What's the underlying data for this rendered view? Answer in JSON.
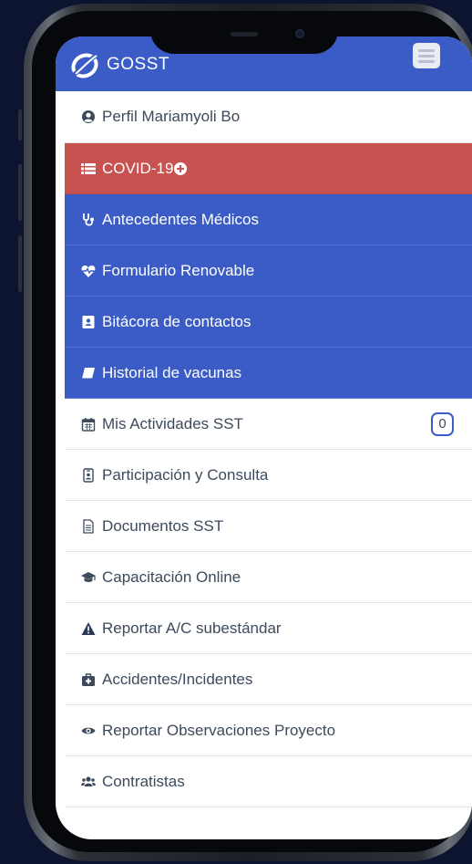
{
  "app": {
    "brand": "GOSST",
    "menu_icon": "hamburger-icon"
  },
  "menu": [
    {
      "label": "Perfil Mariamyoli Bo",
      "icon": "user-circle-icon",
      "style": "plain"
    },
    {
      "label": "COVID-19",
      "icon": "list-icon",
      "style": "covid",
      "trailing_icon": "plus-circle-icon"
    },
    {
      "label": "Antecedentes Médicos",
      "icon": "stethoscope-icon",
      "style": "blue"
    },
    {
      "label": "Formulario Renovable",
      "icon": "heartbeat-icon",
      "style": "blue"
    },
    {
      "label": "Bitácora de contactos",
      "icon": "address-book-icon",
      "style": "blue"
    },
    {
      "label": "Historial de vacunas",
      "icon": "book-icon",
      "style": "blue"
    },
    {
      "label": "Mis Actividades SST",
      "icon": "calendar-icon",
      "style": "plain",
      "badge": "0"
    },
    {
      "label": "Participación y Consulta",
      "icon": "id-badge-icon",
      "style": "plain"
    },
    {
      "label": "Documentos SST",
      "icon": "file-icon",
      "style": "plain"
    },
    {
      "label": "Capacitación Online",
      "icon": "graduation-cap-icon",
      "style": "plain"
    },
    {
      "label": "Reportar A/C subestándar",
      "icon": "warning-icon",
      "style": "plain"
    },
    {
      "label": "Accidentes/Incidentes",
      "icon": "medkit-icon",
      "style": "plain"
    },
    {
      "label": "Reportar Observaciones Proyecto",
      "icon": "eye-icon",
      "style": "plain"
    },
    {
      "label": "Contratistas",
      "icon": "users-icon",
      "style": "plain"
    }
  ],
  "colors": {
    "header": "#3b5cc6",
    "covid": "#c8524f",
    "text": "#3d4a5c",
    "background": "#0d1430"
  }
}
